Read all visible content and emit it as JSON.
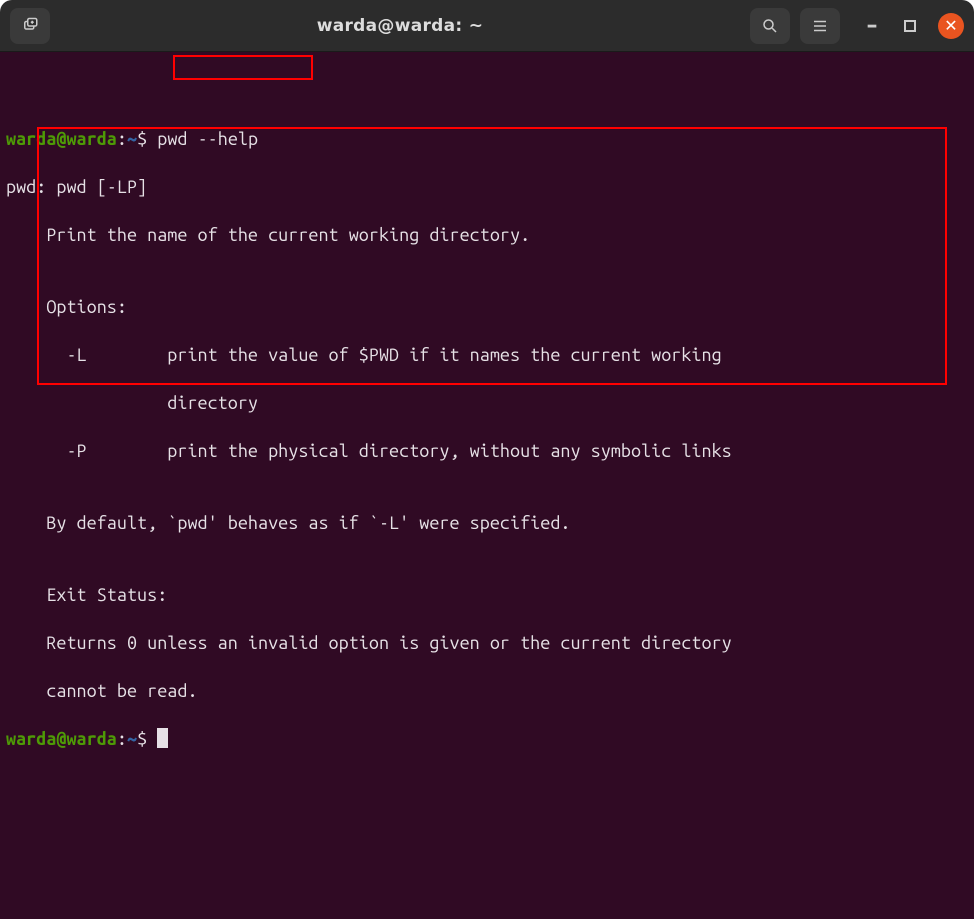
{
  "titlebar": {
    "title": "warda@warda: ~"
  },
  "prompt": {
    "user_host": "warda@warda",
    "colon": ":",
    "path": "~",
    "dollar": "$"
  },
  "command": "pwd --help",
  "output": {
    "usage": "pwd: pwd [-LP]",
    "desc": "    Print the name of the current working directory.",
    "blank1": "",
    "options_header": "    Options:",
    "opt_L_1": "      -L        print the value of $PWD if it names the current working",
    "opt_L_2": "                directory",
    "opt_P": "      -P        print the physical directory, without any symbolic links",
    "blank2": "",
    "default_l": "    By default, `pwd' behaves as if `-L' were specified.",
    "blank3": "",
    "exit_header": "    Exit Status:",
    "exit_1": "    Returns 0 unless an invalid option is given or the current directory",
    "exit_2": "    cannot be read."
  }
}
